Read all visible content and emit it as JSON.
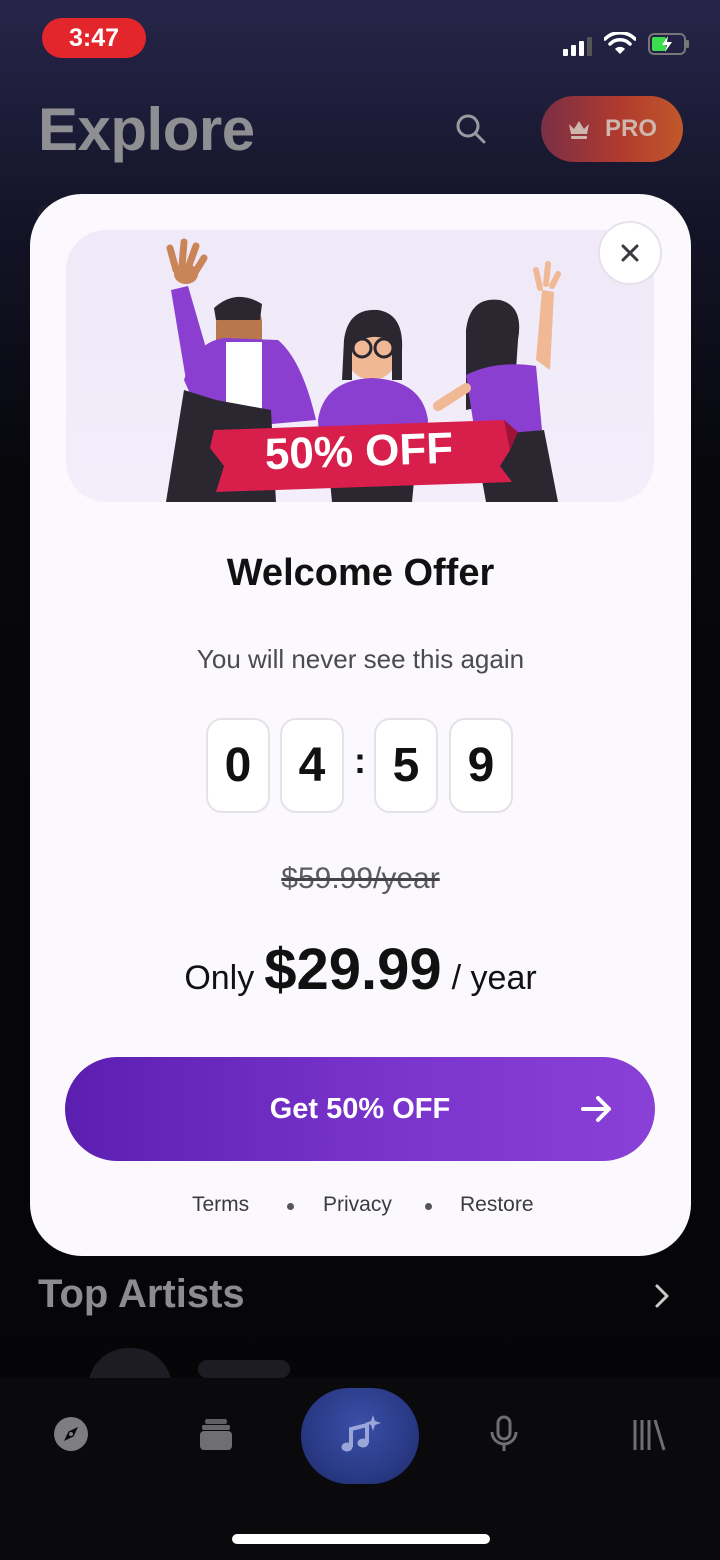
{
  "status_bar": {
    "time": "3:47"
  },
  "header": {
    "title": "Explore",
    "pro_label": "PRO"
  },
  "background": {
    "section_title": "Top Artists"
  },
  "modal": {
    "title": "Welcome Offer",
    "subtitle": "You will never see this again",
    "badge": "50% OFF",
    "countdown": {
      "d1": "0",
      "d2": "4",
      "d3": "5",
      "d4": "9"
    },
    "old_price": "$59.99/year",
    "price_prefix": "Only",
    "price": "$29.99",
    "price_suffix": "/ year",
    "cta_label": "Get 50% OFF",
    "links": {
      "terms": "Terms",
      "privacy": "Privacy",
      "restore": "Restore"
    }
  },
  "tabs": [
    {
      "name": "explore",
      "icon": "compass-icon"
    },
    {
      "name": "library-stack",
      "icon": "stack-icon"
    },
    {
      "name": "create",
      "icon": "music-sparkle-icon"
    },
    {
      "name": "voice",
      "icon": "microphone-icon"
    },
    {
      "name": "library",
      "icon": "library-icon"
    }
  ],
  "colors": {
    "accent": "#7a34cc",
    "time_pill": "#e3262c",
    "badge": "#d81e4a",
    "pro_gradient": "#b03a2e"
  }
}
